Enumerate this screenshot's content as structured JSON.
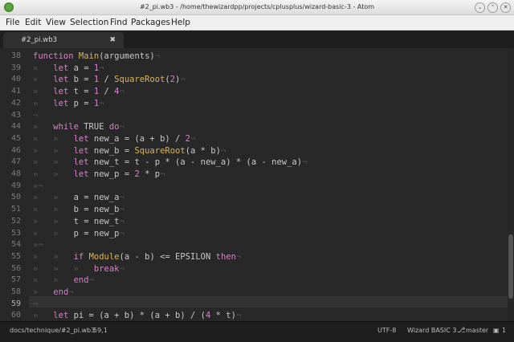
{
  "window": {
    "title": "#2_pi.wb3 - /home/thewizardpp/projects/cplusplus/wizard-basic-3 - Atom",
    "minimize_glyph": "⌄",
    "maximize_glyph": "⌃",
    "close_glyph": "✕"
  },
  "menu": [
    "File",
    "Edit",
    "View",
    "Selection",
    "Find",
    "Packages",
    "Help"
  ],
  "tab": {
    "title": "#2_pi.wb3",
    "close_glyph": "✖"
  },
  "gutter_lines": [
    "38",
    "39",
    "40",
    "41",
    "42",
    "43",
    "44",
    "45",
    "46",
    "47",
    "48",
    "49",
    "50",
    "51",
    "52",
    "53",
    "54",
    "55",
    "56",
    "57",
    "58",
    "59",
    "60"
  ],
  "code": {
    "ws_glyph": "»",
    "eol_glyph": "¬",
    "kw_function": "function",
    "kw_let": "let",
    "kw_while": "while",
    "kw_true": "TRUE",
    "kw_do": "do",
    "kw_if": "if",
    "kw_then": "then",
    "kw_break": "break",
    "kw_end": "end",
    "fn_main": "Main",
    "fn_sqrt": "SquareRoot",
    "fn_module": "Module",
    "id_arguments": "(arguments)",
    "num_1": "1",
    "num_2": "2",
    "num_4": "4",
    "l39_rest": " a = ",
    "l40_rest": " b = ",
    "l40_div": " / ",
    "l40_open": "(",
    "l40_close": ")",
    "l41_rest": " t = ",
    "l41_div": " / ",
    "l42_rest": " p = ",
    "l45_rest": " new_a = (a + b) / ",
    "l46_rest": " new_b = ",
    "l46_args": "(a * b)",
    "l47_rest": " new_t = t - p * (a - new_a) * (a - new_a)",
    "l48_rest": " new_p = ",
    "l48_tail": " * p",
    "l50": "a = new_a",
    "l51": "b = new_b",
    "l52": "t = new_t",
    "l53": "p = new_p",
    "l55_mid": "(a - b) <= EPSILON ",
    "l60_rest": " pi = (a + b) * (a + b) / (",
    "l60_tail": " * t)"
  },
  "status": {
    "path": "docs/technique/#2_pi.wb3",
    "cursor": "59,1",
    "encoding": "UTF-8",
    "grammar": "Wizard BASIC 3",
    "branch_icon": "⎇",
    "branch": "master",
    "updates_icon": "▣",
    "updates": "1"
  },
  "colors": {
    "keyword": "#d782c7",
    "function": "#dbb55a",
    "text": "#c8c8c8",
    "background": "#282828"
  }
}
